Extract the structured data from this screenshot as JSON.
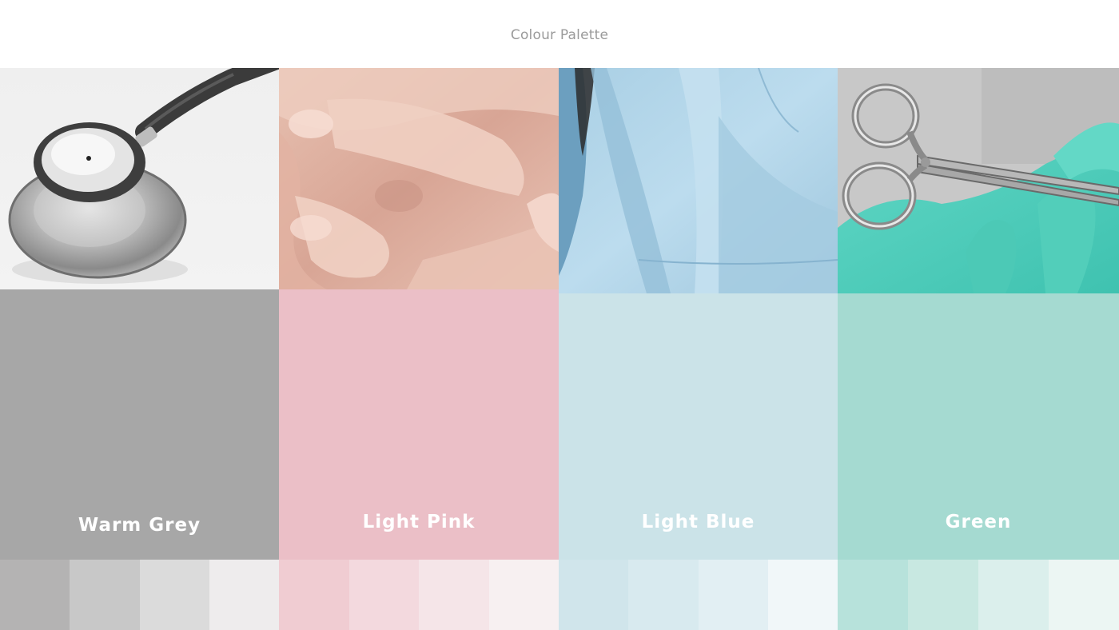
{
  "header": {
    "title": "Colour Palette"
  },
  "palette": [
    {
      "name": "Warm Grey",
      "image": "stethoscope",
      "color": "#a7a7a7",
      "tints": [
        "#b4b3b3",
        "#c8c8c8",
        "#dbdbdb",
        "#eeeced"
      ]
    },
    {
      "name": "Light Pink",
      "image": "hands",
      "color": "#ebbfc7",
      "tints": [
        "#f0ccd2",
        "#f3d9de",
        "#f5e5e8",
        "#f7f0f1"
      ]
    },
    {
      "name": "Light Blue",
      "image": "scrubs",
      "color": "#cbe3e8",
      "tints": [
        "#d0e5eb",
        "#d8eaef",
        "#e2eff3",
        "#f1f7f9"
      ]
    },
    {
      "name": "Green",
      "image": "surgical-scissors",
      "color": "#a5dad1",
      "tints": [
        "#b7e2db",
        "#c8e8e1",
        "#dbefec",
        "#ecf6f3"
      ]
    }
  ]
}
